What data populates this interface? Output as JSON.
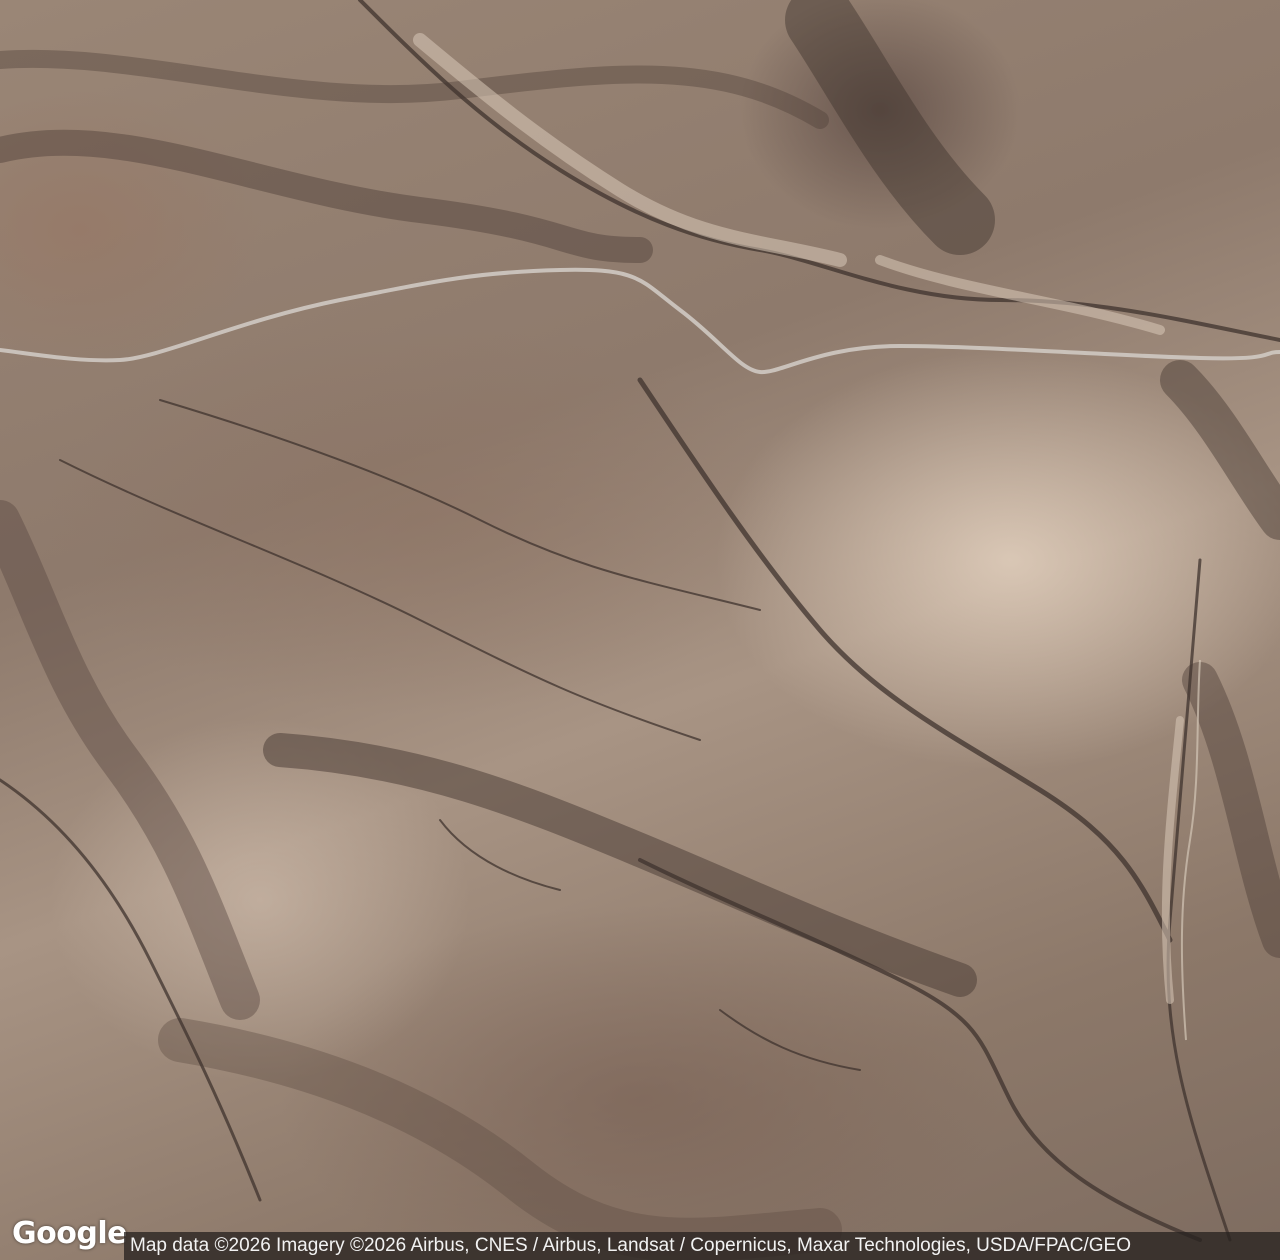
{
  "map": {
    "type": "satellite",
    "colors": {
      "terrain_light": "#d9c8b6",
      "terrain_mid": "#9a8676",
      "terrain_dark": "#4e3f38",
      "road": "#cfc9c2"
    }
  },
  "branding": {
    "logo_text": "Google"
  },
  "attribution": {
    "text": "Map data ©2026 Imagery ©2026 Airbus, CNES / Airbus, Landsat / Copernicus, Maxar Technologies, USDA/FPAC/GEO"
  }
}
